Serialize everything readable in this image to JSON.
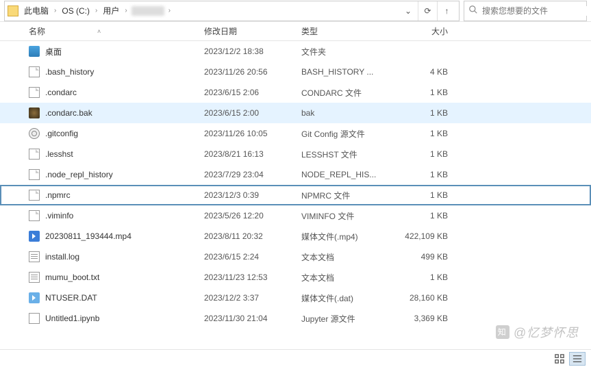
{
  "breadcrumb": {
    "items": [
      "此电脑",
      "OS (C:)",
      "用户"
    ],
    "blurred_last": true
  },
  "search": {
    "placeholder": "搜索您想要的文件"
  },
  "columns": {
    "name": "名称",
    "date": "修改日期",
    "type": "类型",
    "size": "大小"
  },
  "files": [
    {
      "icon": "desktop",
      "name": "桌面",
      "date": "2023/12/2 18:38",
      "type": "文件夹",
      "size": ""
    },
    {
      "icon": "file",
      "name": ".bash_history",
      "date": "2023/11/26 20:56",
      "type": "BASH_HISTORY ...",
      "size": "4 KB"
    },
    {
      "icon": "file",
      "name": ".condarc",
      "date": "2023/6/15 2:06",
      "type": "CONDARC 文件",
      "size": "1 KB"
    },
    {
      "icon": "bak",
      "name": ".condarc.bak",
      "date": "2023/6/15 2:00",
      "type": "bak",
      "size": "1 KB",
      "selected": true
    },
    {
      "icon": "gear",
      "name": ".gitconfig",
      "date": "2023/11/26 10:05",
      "type": "Git Config 源文件",
      "size": "1 KB"
    },
    {
      "icon": "file",
      "name": ".lesshst",
      "date": "2023/8/21 16:13",
      "type": "LESSHST 文件",
      "size": "1 KB"
    },
    {
      "icon": "file",
      "name": ".node_repl_history",
      "date": "2023/7/29 23:04",
      "type": "NODE_REPL_HIS...",
      "size": "1 KB"
    },
    {
      "icon": "file",
      "name": ".npmrc",
      "date": "2023/12/3 0:39",
      "type": "NPMRC 文件",
      "size": "1 KB",
      "focused": true
    },
    {
      "icon": "file",
      "name": ".viminfo",
      "date": "2023/5/26 12:20",
      "type": "VIMINFO 文件",
      "size": "1 KB"
    },
    {
      "icon": "video",
      "name": "20230811_193444.mp4",
      "date": "2023/8/11 20:32",
      "type": "媒体文件(.mp4)",
      "size": "422,109 KB"
    },
    {
      "icon": "text",
      "name": "install.log",
      "date": "2023/6/15 2:24",
      "type": "文本文档",
      "size": "499 KB"
    },
    {
      "icon": "text",
      "name": "mumu_boot.txt",
      "date": "2023/11/23 12:53",
      "type": "文本文档",
      "size": "1 KB"
    },
    {
      "icon": "dat",
      "name": "NTUSER.DAT",
      "date": "2023/12/2 3:37",
      "type": "媒体文件(.dat)",
      "size": "28,160 KB"
    },
    {
      "icon": "jupyter",
      "name": "Untitled1.ipynb",
      "date": "2023/11/30 21:04",
      "type": "Jupyter 源文件",
      "size": "3,369 KB"
    }
  ],
  "watermark": "@忆梦怀思"
}
